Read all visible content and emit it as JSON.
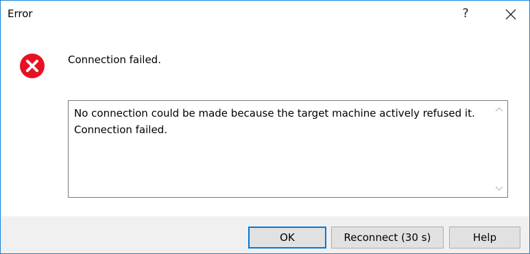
{
  "window": {
    "title": "Error",
    "help_glyph": "?",
    "close_icon": "close-icon"
  },
  "message": {
    "icon": "error-icon",
    "headline": "Connection failed.",
    "details_lines": [
      "No connection could be made because the target machine actively refused it.",
      "Connection failed."
    ]
  },
  "buttons": {
    "ok": "OK",
    "reconnect": "Reconnect (30 s)",
    "help": "Help"
  },
  "colors": {
    "accent": "#0078d7",
    "error_red": "#e81123",
    "footer_bg": "#f0f0f0"
  }
}
